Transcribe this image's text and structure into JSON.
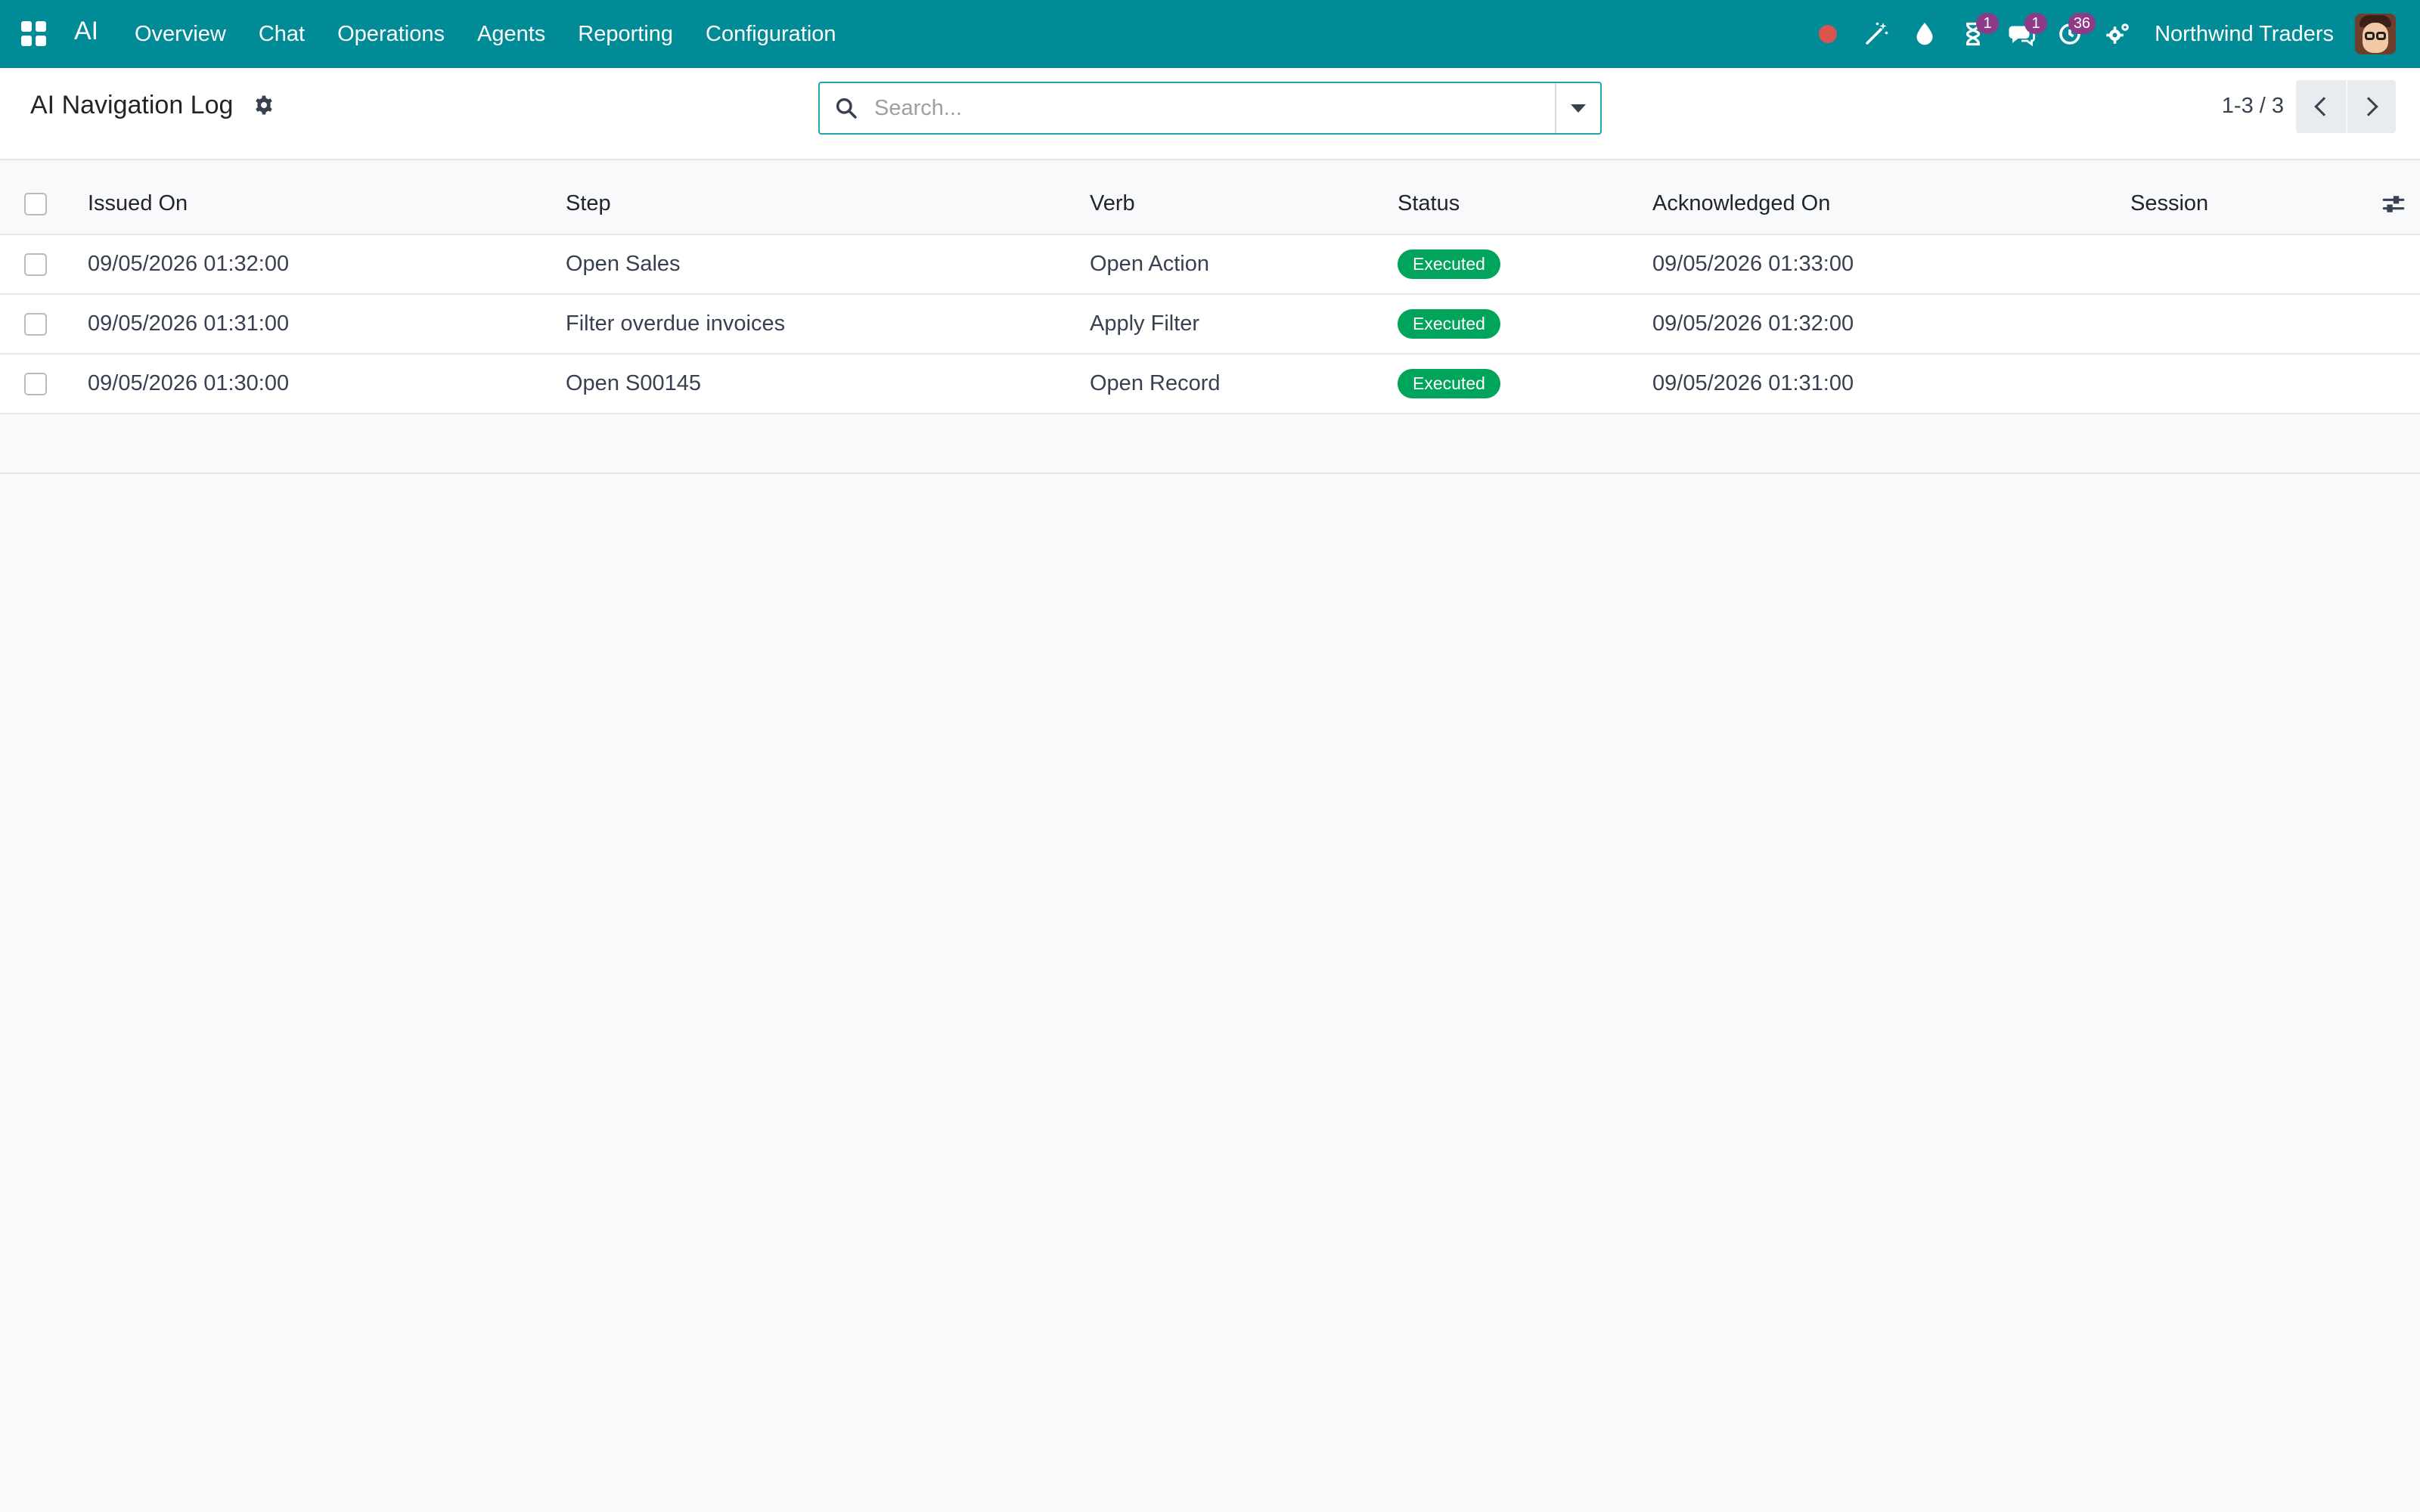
{
  "navbar": {
    "brand": "AI",
    "menu": [
      "Overview",
      "Chat",
      "Operations",
      "Agents",
      "Reporting",
      "Configuration"
    ],
    "company": "Northwind Traders",
    "badges": {
      "activities": "1",
      "messages": "1",
      "updates": "36"
    },
    "icons": [
      "record-icon",
      "magic-wand-icon",
      "drop-icon",
      "hourglass-icon",
      "chat-icon",
      "clock-icon",
      "settings-icon"
    ],
    "accent": "#008b97"
  },
  "control_panel": {
    "title": "AI Navigation Log",
    "search_placeholder": "Search...",
    "pager": "1-3 / 3"
  },
  "table": {
    "columns": [
      "Issued On",
      "Step",
      "Verb",
      "Status",
      "Acknowledged On",
      "Session"
    ],
    "rows": [
      {
        "issued_on": "09/05/2026 01:32:00",
        "step": "Open Sales",
        "verb": "Open Action",
        "status": "Executed",
        "acknowledged_on": "09/05/2026 01:33:00",
        "session": ""
      },
      {
        "issued_on": "09/05/2026 01:31:00",
        "step": "Filter overdue invoices",
        "verb": "Apply Filter",
        "status": "Executed",
        "acknowledged_on": "09/05/2026 01:32:00",
        "session": ""
      },
      {
        "issued_on": "09/05/2026 01:30:00",
        "step": "Open S00145",
        "verb": "Open Record",
        "status": "Executed",
        "acknowledged_on": "09/05/2026 01:31:00",
        "session": ""
      }
    ],
    "status_color": "#00a45a"
  }
}
